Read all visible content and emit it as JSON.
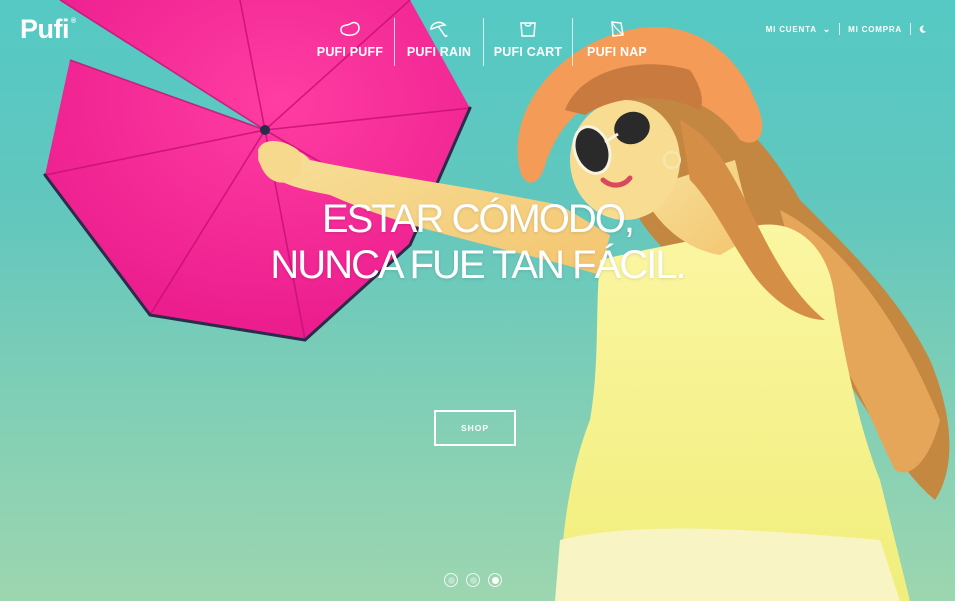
{
  "brand": {
    "name": "Pufi",
    "mark": "®"
  },
  "nav": {
    "items": [
      {
        "label": "PUFI PUFF",
        "icon": "puff-bean-icon"
      },
      {
        "label": "PUFI RAIN",
        "icon": "umbrella-icon"
      },
      {
        "label": "PUFI CART",
        "icon": "cart-bag-icon"
      },
      {
        "label": "PUFI NAP",
        "icon": "nap-pillow-icon"
      }
    ]
  },
  "account": {
    "my_account": "MI CUENTA",
    "my_purchase": "MI COMPRA",
    "cart_icon": "cart-moon-icon"
  },
  "hero": {
    "headline_line1": "ESTAR CÓMODO,",
    "headline_line2": "NUNCA FUE TAN FÁCIL.",
    "cta": "SHOP",
    "slides": 3,
    "active_slide": 3
  },
  "colors": {
    "sky": "#5fc8c0",
    "umbrella": "#f0208f",
    "top": "#f4f18a",
    "hat": "#f29a55",
    "text": "#ffffff"
  }
}
